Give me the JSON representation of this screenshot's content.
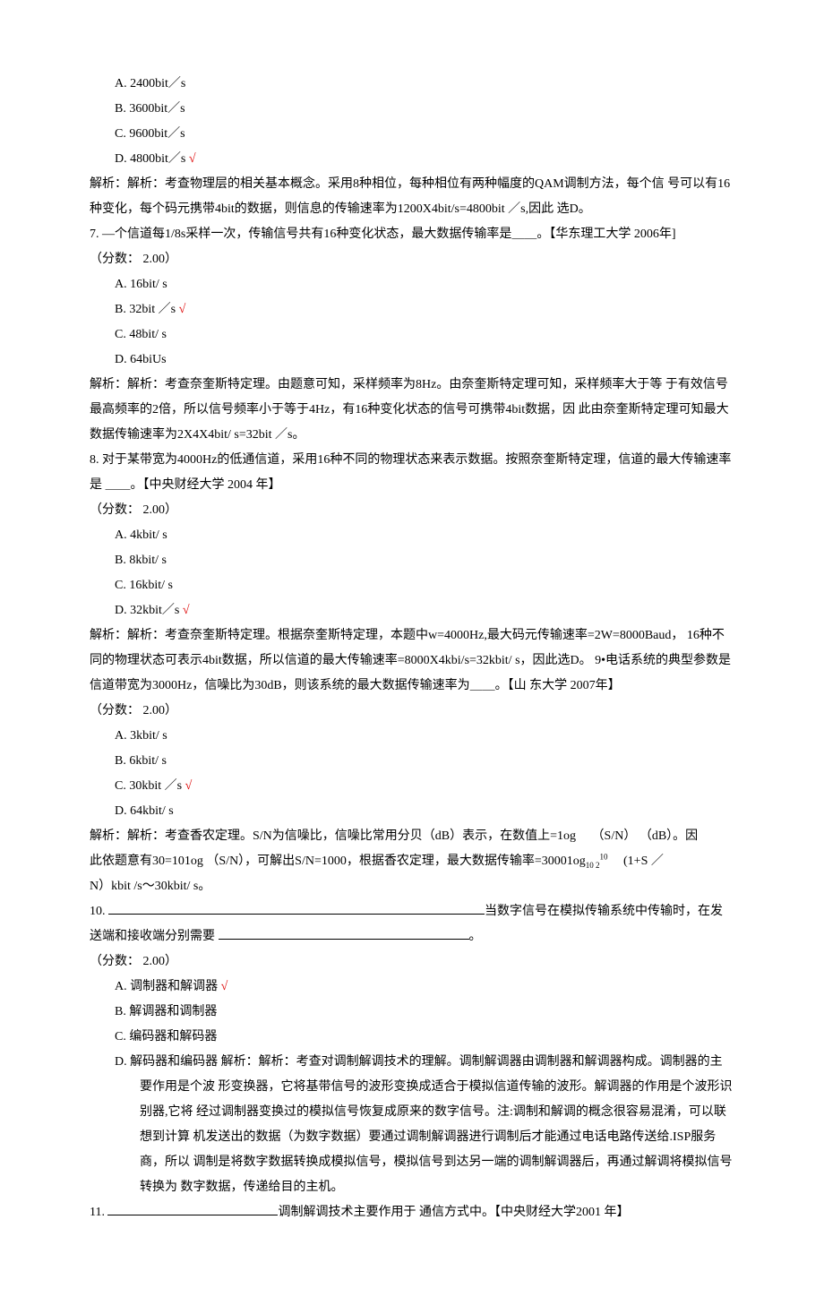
{
  "q6": {
    "options": {
      "a": "A. 2400bit／s",
      "b": "B. 3600bit／s",
      "c": "C. 9600bit／s",
      "d": "D. 4800bit／s"
    },
    "analysis": "解析：解析：考查物理层的相关基本概念。采用8种相位，每种相位有两种幅度的QAM调制方法，每个信 号可以有16种变化，每个码元携带4bit的数据，则信息的传输速率为1200X4bit/s=4800bit ／s,因此 选D。"
  },
  "q7": {
    "stem": "7. —个信道每1/8s采样一次，传输信号共有16种变化状态，最大数据传输率是＿＿。【华东理工大学 2006年]",
    "score": "（分数： 2.00）",
    "options": {
      "a": "A. 16bit/ s",
      "b": "B. 32bit ／s",
      "c": "C. 48bit/ s",
      "d": "D. 64biUs"
    },
    "analysis": "解析：解析：考查奈奎斯特定理。由题意可知，采样频率为8Hz。由奈奎斯特定理可知，采样频率大于等 于有效信号最高频率的2倍，所以信号频率小于等于4Hz，有16种变化状态的信号可携带4bit数据，因 此由奈奎斯特定理可知最大数据传输速率为2X4X4bit/ s=32bit ／s。"
  },
  "q8": {
    "stem": "8. 对于某带宽为4000Hz的低通信道，采用16种不同的物理状态来表示数据。按照奈奎斯特定理，信道的最大传输速率是 ＿＿。【中央财经大学 2004 年】",
    "score": "（分数： 2.00）",
    "options": {
      "a": "A. 4kbit/ s",
      "b": "B. 8kbit/ s",
      "c": "C. 16kbit/ s",
      "d": "D. 32kbit／s"
    },
    "analysis": "解析：解析：考查奈奎斯特定理。根据奈奎斯特定理，本题中w=4000Hz,最大码元传输速率=2W=8000Baud， 16种不同的物理状态可表示4bit数据，所以信道的最大传输速率=8000X4kbi/s=32kbit/ s，因此选D。 9•电话系统的典型参数是信道带宽为3000Hz，信噪比为30dB，则该系统的最大数据传输速率为＿＿。【山 东大学 2007年】"
  },
  "q9": {
    "score": "（分数： 2.00）",
    "options": {
      "a": "A. 3kbit/ s",
      "b": "B. 6kbit/ s",
      "c": "C. 30kbit ／s",
      "d": "D. 64kbit/ s"
    },
    "analysis_p1": "解析：解析：考查香农定理。S/N为信噪比，信噪比常用分贝（dB）表示，在数值上=1og",
    "analysis_p1_tail": "（S/N） （dB）。因",
    "analysis_p2": "此依题意有30=101og （S/N），可解出S/N=1000，根据香农定理，最大数据传输率=30001og",
    "analysis_p2_tail": "(1+S ／",
    "analysis_p3": "N）kbit /s〜30kbit/ s。",
    "sup10": "10",
    "sub102": "10 2"
  },
  "q10": {
    "prefix": "10. ",
    "stem_mid": "当数字信号在模拟传输系统中传输时，在发送端和接收端分别需要 ",
    "stem_end": "。",
    "score": "（分数： 2.00）",
    "options": {
      "a": "A. 调制器和解调器",
      "b": "B. 解调器和调制器",
      "c": "C. 编码器和解码器",
      "d": "D. 解码器和编码器  解析：解析：考查对调制解调技术的理解。调制解调器由调制器和解调器构成。调制器的主要作用是个波 形变换器，它将基带信号的波形变换成适合于模拟信道传输的波形。解调器的作用是个波形识别器,它将   经过调制器变换过的模拟信号恢复成原来的数字信号。注:调制和解调的概念很容易混淆，可以联想到计算 机发送出的数据（为数字数据）要通过调制解调器进行调制后才能通过电话电路传送给.ISP服务商，所以 调制是将数字数据转换成模拟信号，模拟信号到达另一端的调制解调器后，再通过解调将模拟信号转换为 数字数据，传递给目的主机。"
    }
  },
  "q11": {
    "prefix": "11. ",
    "stem_mid": "调制解调技术主要作用于    通信方式中。【中央财经大学2001 年】"
  },
  "check": "√"
}
